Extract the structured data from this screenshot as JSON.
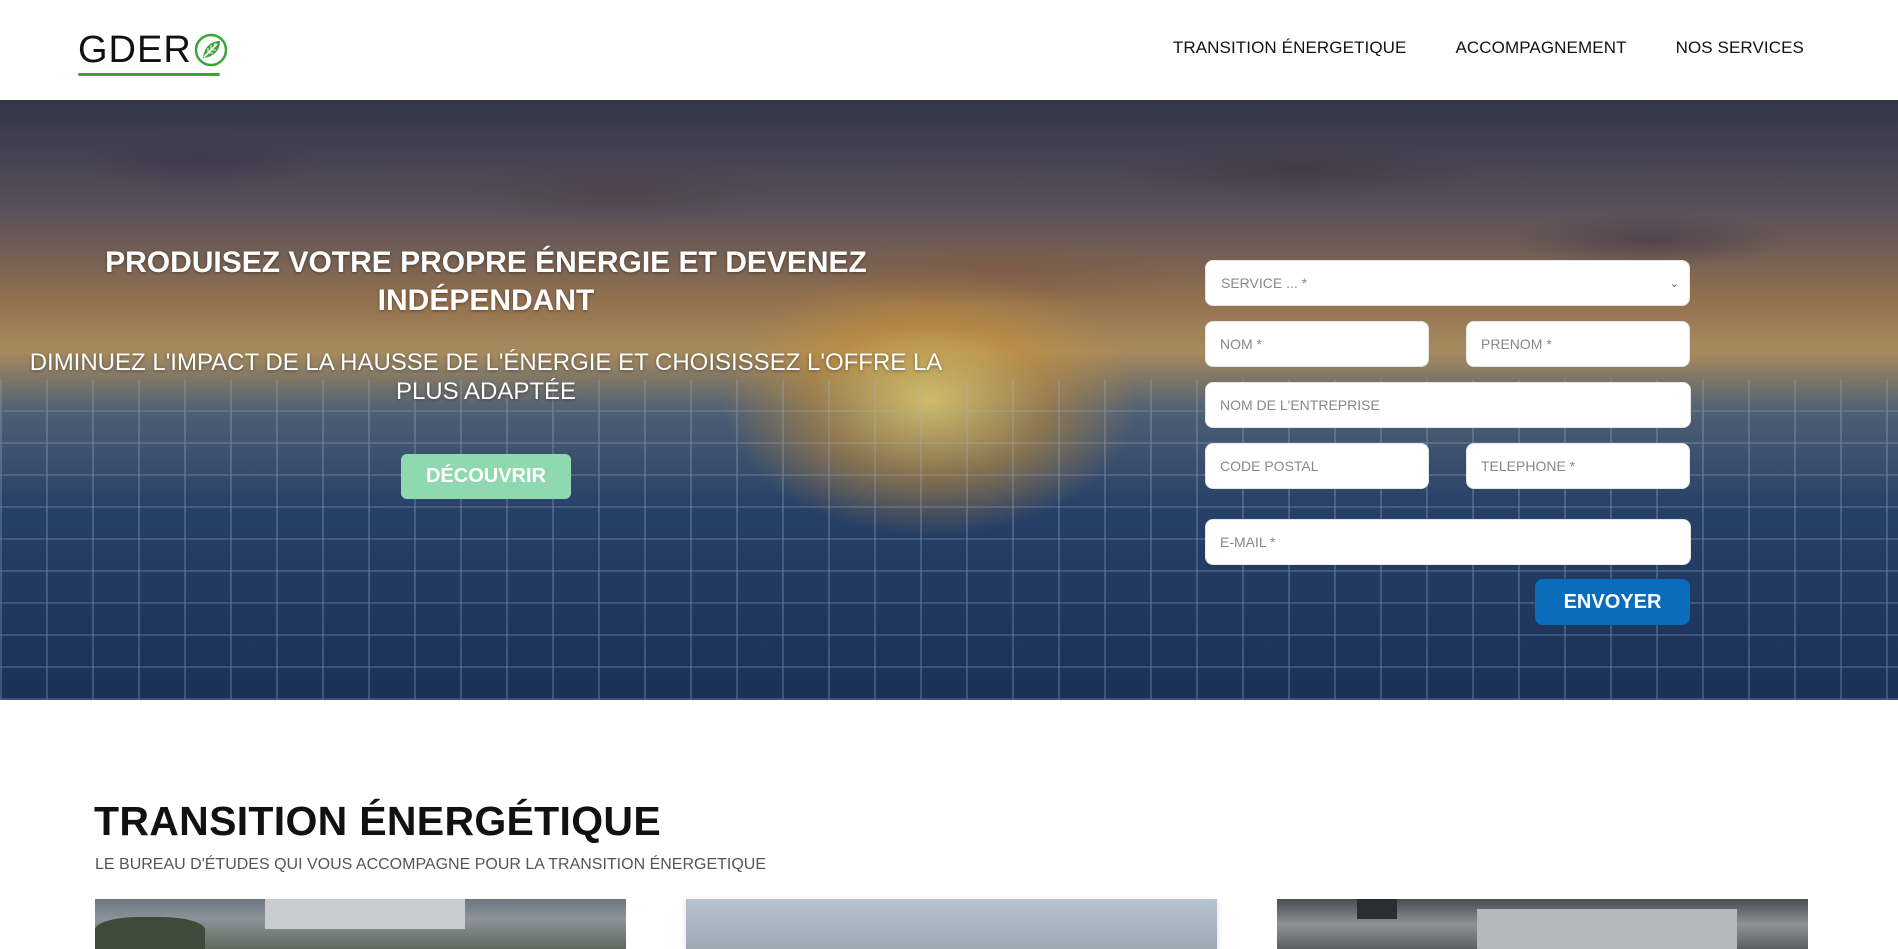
{
  "header": {
    "logo_text": "GDER",
    "nav": [
      "TRANSITION ÉNERGETIQUE",
      "ACCOMPAGNEMENT",
      "NOS SERVICES"
    ]
  },
  "hero": {
    "title": "PRODUISEZ VOTRE PROPRE ÉNERGIE ET DEVENEZ INDÉPENDANT",
    "subtitle": "DIMINUEZ L'IMPACT DE LA HAUSSE DE L'ÉNERGIE ET CHOISISSEZ L'OFFRE LA PLUS ADAPTÉE",
    "cta_label": "DÉCOUVRIR"
  },
  "form": {
    "service_placeholder": "SERVICE ... *",
    "nom_placeholder": "NOM *",
    "prenom_placeholder": "PRENOM *",
    "entreprise_placeholder": "NOM DE L'ENTREPRISE",
    "code_postal_placeholder": "CODE POSTAL",
    "telephone_placeholder": "TELEPHONE *",
    "email_placeholder": "E-MAIL *",
    "submit_label": "ENVOYER"
  },
  "section": {
    "title": "TRANSITION ÉNERGÉTIQUE",
    "subtitle": "LE BUREAU D'ÉTUDES QUI VOUS ACCOMPAGNE POUR LA TRANSITION ÉNERGETIQUE"
  },
  "colors": {
    "accent_green": "#8fd9b0",
    "submit_blue": "#0a6cba",
    "logo_green": "#3aa535"
  }
}
